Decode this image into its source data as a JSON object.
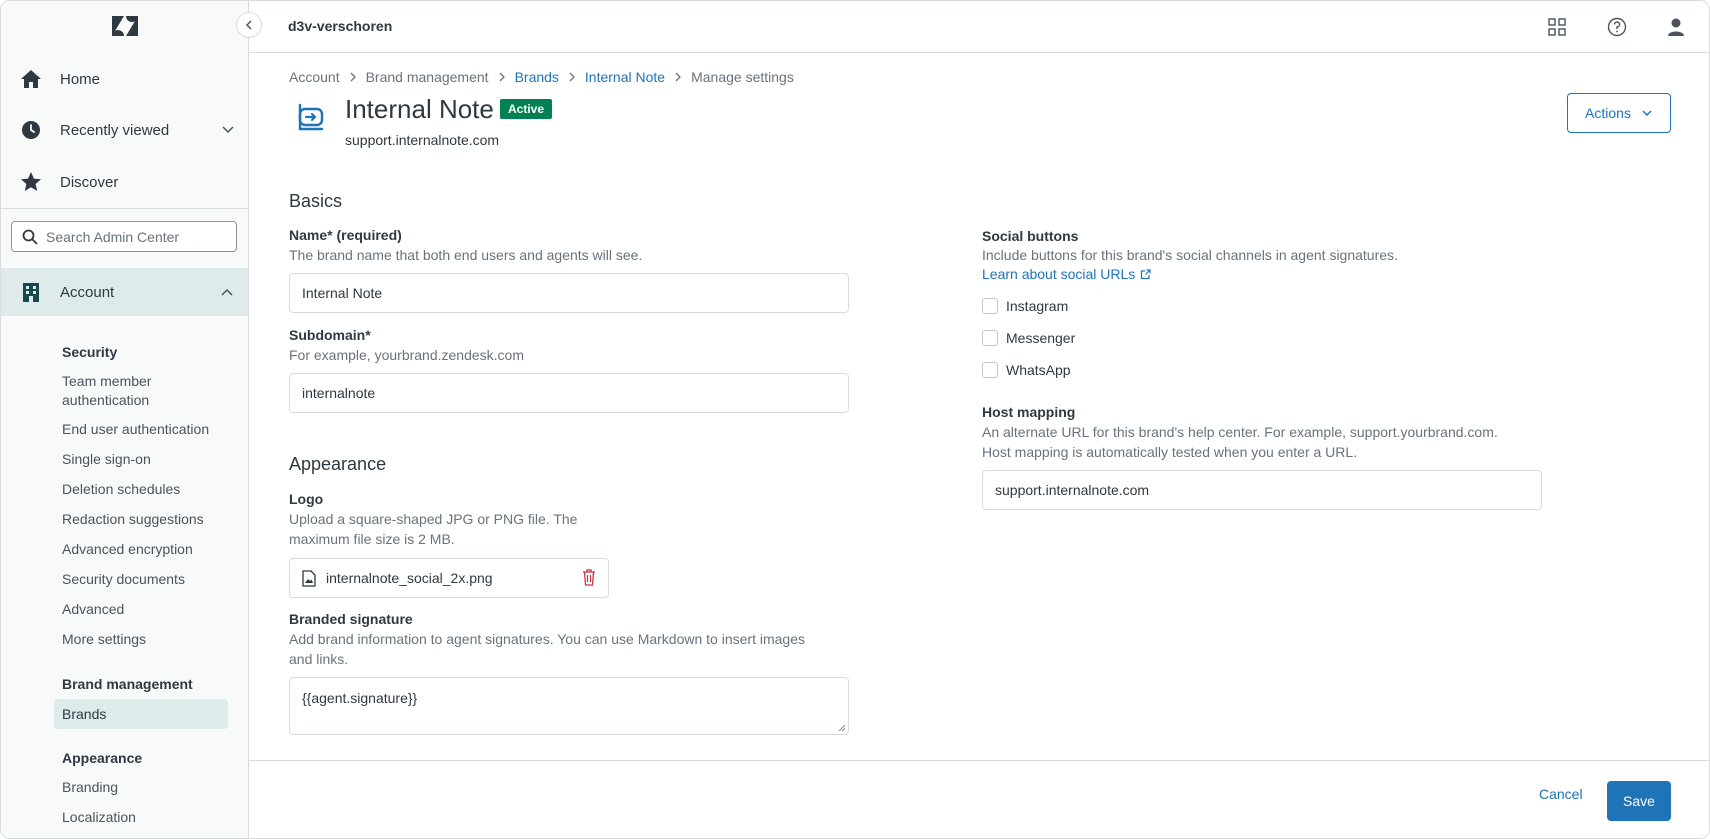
{
  "app": {
    "tenant": "d3v-verschoren"
  },
  "sidebar": {
    "nav": [
      {
        "label": "Home",
        "icon": "home-icon"
      },
      {
        "label": "Recently viewed",
        "icon": "clock-icon"
      },
      {
        "label": "Discover",
        "icon": "star-icon"
      }
    ],
    "search_placeholder": "Search Admin Center",
    "account_label": "Account",
    "security": {
      "heading": "Security",
      "items": [
        "Team member authentication",
        "End user authentication",
        "Single sign-on",
        "Deletion schedules",
        "Redaction suggestions",
        "Advanced encryption",
        "Security documents",
        "Advanced",
        "More settings"
      ]
    },
    "brand_management": {
      "heading": "Brand management",
      "active_item": "Brands"
    },
    "appearance": {
      "heading": "Appearance",
      "items": [
        "Branding",
        "Localization"
      ]
    }
  },
  "breadcrumb": [
    "Account",
    "Brand management",
    "Brands",
    "Internal Note",
    "Manage settings"
  ],
  "header": {
    "title": "Internal Note",
    "status_badge": "Active",
    "domain": "support.internalnote.com",
    "actions_label": "Actions"
  },
  "basics": {
    "section_title": "Basics",
    "name": {
      "label": "Name* (required)",
      "hint": "The brand name that both end users and agents will see.",
      "value": "Internal Note"
    },
    "subdomain": {
      "label": "Subdomain*",
      "hint": "For example, yourbrand.zendesk.com",
      "value": "internalnote"
    }
  },
  "appearance": {
    "section_title": "Appearance",
    "logo": {
      "label": "Logo",
      "hint_line1": "Upload a square-shaped JPG or PNG file. The",
      "hint_line2": "maximum file size is 2 MB.",
      "file_name": "internalnote_social_2x.png"
    },
    "signature": {
      "label": "Branded signature",
      "hint_line1": "Add brand information to agent signatures. You can use Markdown to insert images",
      "hint_line2": "and links.",
      "value": "{{agent.signature}}"
    }
  },
  "social": {
    "label": "Social buttons",
    "hint": "Include buttons for this brand's social channels in agent signatures.",
    "learn_link": "Learn about social URLs",
    "options": [
      {
        "label": "Instagram",
        "checked": false
      },
      {
        "label": "Messenger",
        "checked": false
      },
      {
        "label": "WhatsApp",
        "checked": false
      }
    ]
  },
  "host_mapping": {
    "label": "Host mapping",
    "hint_line1": "An alternate URL for this brand's help center. For example, support.yourbrand.com.",
    "hint_line2": "Host mapping is automatically tested when you enter a URL.",
    "value": "support.internalnote.com"
  },
  "footer": {
    "cancel_label": "Cancel",
    "save_label": "Save"
  },
  "colors": {
    "accent": "#1f73b7",
    "active_badge": "#038153",
    "sidebar_active": "#dfeaea",
    "danger": "#cc3340"
  }
}
